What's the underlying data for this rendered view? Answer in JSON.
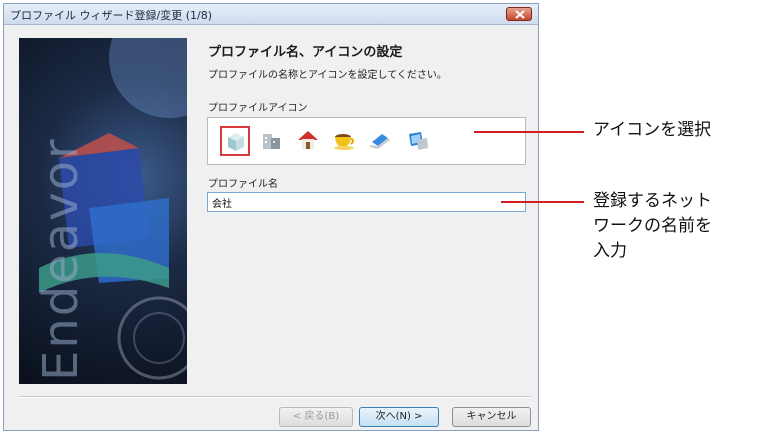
{
  "window": {
    "title": "プロファイル ウィザード登録/変更 (1/8)"
  },
  "banner": {
    "brand": "Endeavor"
  },
  "content": {
    "heading": "プロファイル名、アイコンの設定",
    "description": "プロファイルの名称とアイコンを設定してください。",
    "icon_label": "プロファイルアイコン",
    "icons": [
      "cube-icon",
      "buildings-icon",
      "house-icon",
      "coffee-cup-icon",
      "laptop-icon",
      "laptop-screen-icon"
    ],
    "selected_icon": "cube-icon",
    "name_label": "プロファイル名",
    "name_value": "会社"
  },
  "buttons": {
    "back": "< 戻る(B)",
    "next": "次へ(N) >",
    "cancel": "キャンセル"
  },
  "callouts": {
    "icon_select": "アイコンを選択",
    "name_input_lines": [
      "登録するネット",
      "ワークの名前を",
      "入力"
    ]
  },
  "colors": {
    "callout_line": "#d21e1e",
    "selected_icon_border": "#d63a3a",
    "input_border": "#7aa7d9"
  }
}
